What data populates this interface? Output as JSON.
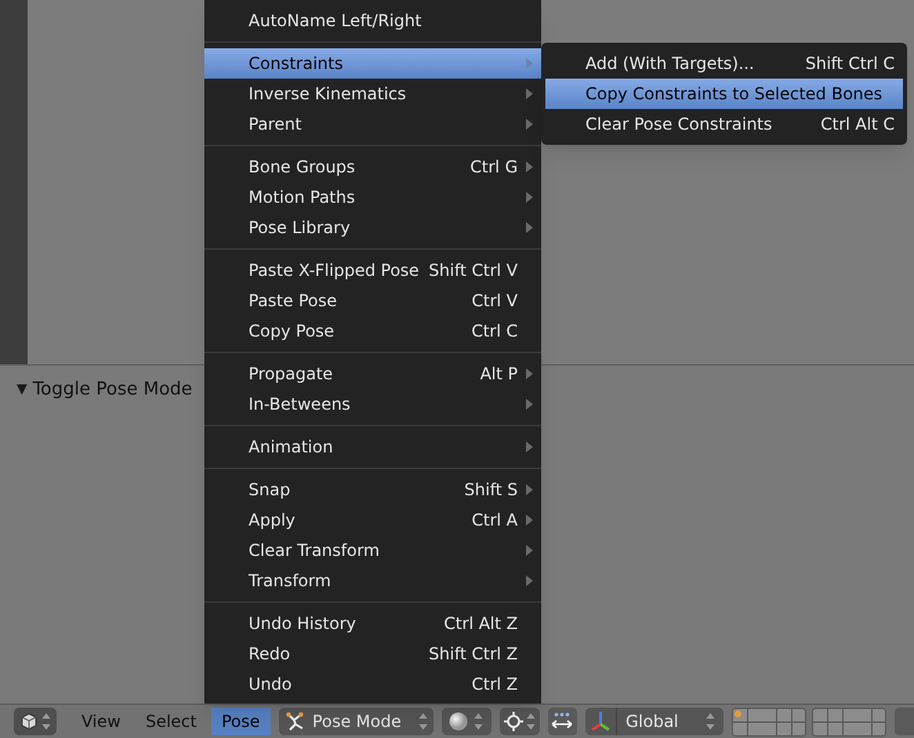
{
  "viewport": {
    "panel_toggle": "▼",
    "panel_title": "Toggle Pose Mode"
  },
  "menu": {
    "sections": [
      [
        {
          "label": "AutoName Left/Right",
          "submenu": false,
          "selected": false
        }
      ],
      [
        {
          "label": "Constraints",
          "submenu": true,
          "selected": true
        },
        {
          "label": "Inverse Kinematics",
          "submenu": true,
          "selected": false
        },
        {
          "label": "Parent",
          "submenu": true,
          "selected": false
        }
      ],
      [
        {
          "label": "Bone Groups",
          "shortcut": "Ctrl G",
          "submenu": true,
          "selected": false
        },
        {
          "label": "Motion Paths",
          "submenu": true,
          "selected": false
        },
        {
          "label": "Pose Library",
          "submenu": true,
          "selected": false
        }
      ],
      [
        {
          "label": "Paste X-Flipped Pose",
          "shortcut": "Shift Ctrl V",
          "submenu": false,
          "selected": false
        },
        {
          "label": "Paste Pose",
          "shortcut": "Ctrl V",
          "submenu": false,
          "selected": false
        },
        {
          "label": "Copy Pose",
          "shortcut": "Ctrl C",
          "submenu": false,
          "selected": false
        }
      ],
      [
        {
          "label": "Propagate",
          "shortcut": "Alt P",
          "submenu": true,
          "selected": false
        },
        {
          "label": "In-Betweens",
          "submenu": true,
          "selected": false
        }
      ],
      [
        {
          "label": "Animation",
          "submenu": true,
          "selected": false
        }
      ],
      [
        {
          "label": "Snap",
          "shortcut": "Shift S",
          "submenu": true,
          "selected": false
        },
        {
          "label": "Apply",
          "shortcut": "Ctrl A",
          "submenu": true,
          "selected": false
        },
        {
          "label": "Clear Transform",
          "submenu": true,
          "selected": false
        },
        {
          "label": "Transform",
          "submenu": true,
          "selected": false
        }
      ],
      [
        {
          "label": "Undo History",
          "shortcut": "Ctrl Alt Z",
          "submenu": false,
          "selected": false
        },
        {
          "label": "Redo",
          "shortcut": "Shift Ctrl Z",
          "submenu": false,
          "selected": false
        },
        {
          "label": "Undo",
          "shortcut": "Ctrl Z",
          "submenu": false,
          "selected": false
        }
      ]
    ]
  },
  "submenu": {
    "items": [
      {
        "label": "Add (With Targets)...",
        "shortcut": "Shift Ctrl C",
        "selected": false
      },
      {
        "label": "Copy Constraints to Selected Bones",
        "selected": true
      },
      {
        "label": "Clear Pose Constraints",
        "shortcut": "Ctrl Alt C",
        "selected": false
      }
    ]
  },
  "header": {
    "menus": [
      {
        "label": "View",
        "selected": false
      },
      {
        "label": "Select",
        "selected": false
      },
      {
        "label": "Pose",
        "selected": true
      }
    ],
    "mode": "Pose Mode",
    "orientation": "Global",
    "layers": [
      {
        "used": true
      },
      {
        "used": false
      },
      {
        "used": false
      },
      {
        "used": false
      },
      {
        "used": false
      },
      {
        "used": false
      },
      {
        "used": false
      },
      {
        "used": false
      },
      {
        "used": false
      },
      {
        "used": false
      },
      {
        "used": false
      },
      {
        "used": false
      },
      {
        "used": false
      },
      {
        "used": false
      },
      {
        "used": false
      },
      {
        "used": false
      },
      {
        "used": false
      },
      {
        "used": false
      },
      {
        "used": false
      },
      {
        "used": false
      }
    ]
  }
}
